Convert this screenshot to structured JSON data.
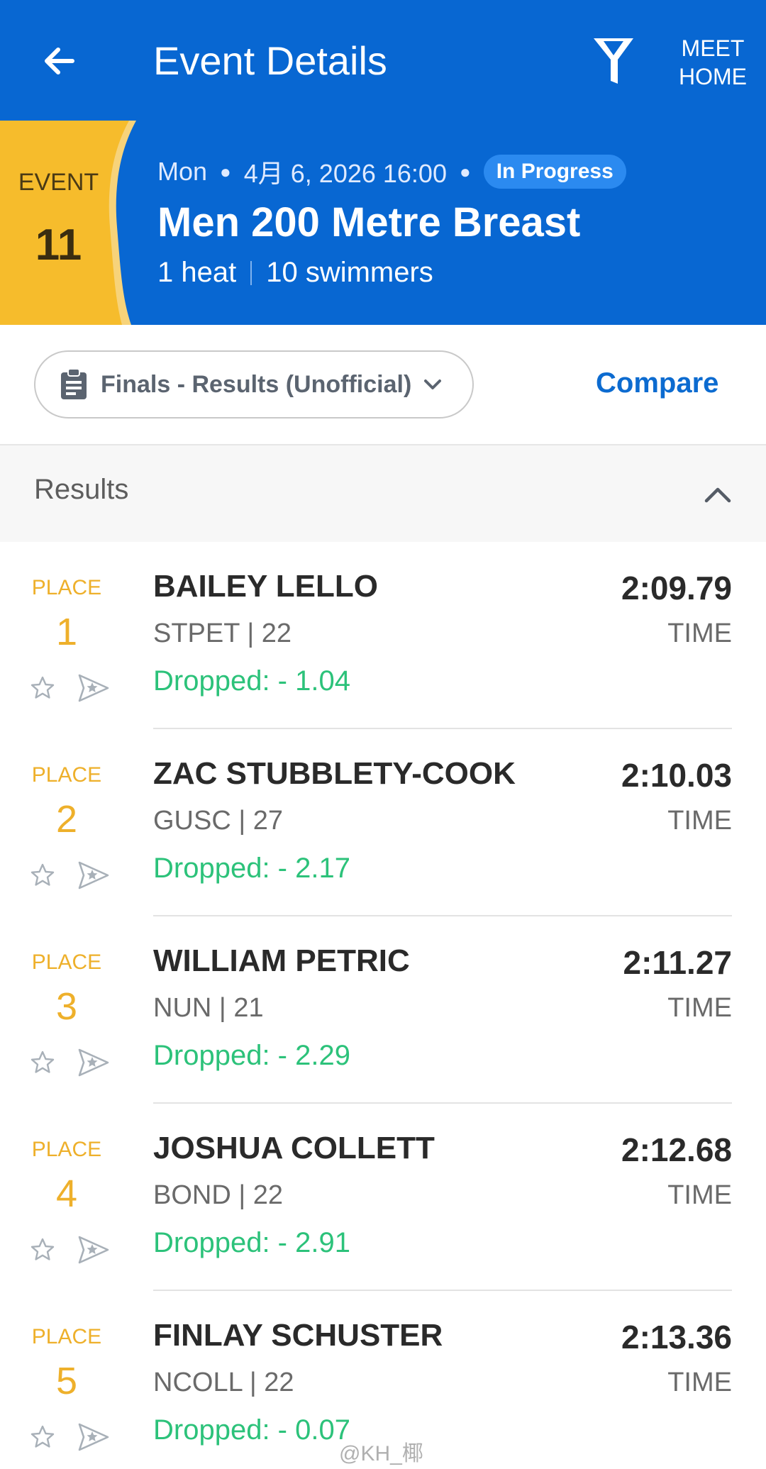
{
  "app_bar": {
    "title": "Event Details",
    "meet_home_label": "MEET HOME",
    "icons": {
      "back": "arrow-left-icon",
      "filter": "filter-funnel-icon"
    },
    "colors": {
      "background": "#0867d2",
      "foreground": "#ffffff"
    }
  },
  "event": {
    "badge_label": "EVENT",
    "number": "11",
    "day": "Mon",
    "datetime": "4月 6, 2026 16:00",
    "status": "In Progress",
    "name": "Men 200 Metre Breast",
    "heats": "1 heat",
    "swimmers": "10 swimmers",
    "colors": {
      "badge": "#f6bc2c",
      "status": "#2b8af0"
    }
  },
  "filter": {
    "round_label": "Finals - Results (Unofficial)",
    "compare_label": "Compare",
    "icons": {
      "round": "clipboard-icon",
      "dropdown": "chevron-down-icon"
    }
  },
  "results_section": {
    "title": "Results",
    "icons": {
      "collapse": "chevron-up-icon"
    }
  },
  "results": [
    {
      "place_label": "PLACE",
      "place": "1",
      "name": "BAILEY LELLO",
      "team_age": "STPET | 22",
      "dropped": "Dropped: - 1.04",
      "time": "2:09.79",
      "time_label": "TIME"
    },
    {
      "place_label": "PLACE",
      "place": "2",
      "name": "ZAC STUBBLETY-COOK",
      "team_age": "GUSC | 27",
      "dropped": "Dropped: - 2.17",
      "time": "2:10.03",
      "time_label": "TIME"
    },
    {
      "place_label": "PLACE",
      "place": "3",
      "name": "WILLIAM PETRIC",
      "team_age": "NUN | 21",
      "dropped": "Dropped: - 2.29",
      "time": "2:11.27",
      "time_label": "TIME"
    },
    {
      "place_label": "PLACE",
      "place": "4",
      "name": "JOSHUA COLLETT",
      "team_age": "BOND | 22",
      "dropped": "Dropped: - 2.91",
      "time": "2:12.68",
      "time_label": "TIME"
    },
    {
      "place_label": "PLACE",
      "place": "5",
      "name": "FINLAY SCHUSTER",
      "team_age": "NCOLL | 22",
      "dropped": "Dropped: - 0.07",
      "time": "2:13.36",
      "time_label": "TIME"
    }
  ],
  "row_icons": {
    "favorite": "star-outline-icon",
    "share": "share-arrow-star-icon"
  },
  "colors": {
    "place": "#eeb02b",
    "dropped": "#2cc27a",
    "link": "#0c6bd0"
  },
  "watermark": "@KH_椰"
}
